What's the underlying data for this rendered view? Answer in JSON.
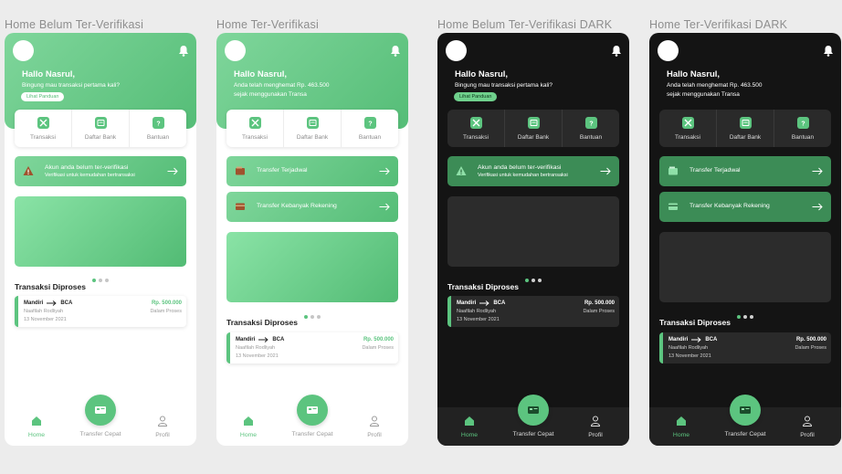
{
  "frames": [
    {
      "title": "Home Belum Ter-Verifikasi",
      "theme": "light",
      "greeting": "Hallo Nasrul,",
      "subtext_line1": "Bingung mau transaksi pertama kali?",
      "guide_button": "Lihat Panduan",
      "notice_title": "Akun anda belum ter-verifikasi",
      "notice_sub": "Verifikasi untuk kemudahan bertransaksi"
    },
    {
      "title": "Home Ter-Verifikasi",
      "theme": "light",
      "greeting": "Hallo Nasrul,",
      "subtext_line1": "Anda telah menghemat Rp. 463.500",
      "subtext_line2": "sejak menggunakan Transa",
      "action_1": "Transfer Terjadwal",
      "action_2": "Transfer Kebanyak Rekening"
    },
    {
      "title": "Home Belum Ter-Verifikasi DARK",
      "theme": "dark",
      "greeting": "Hallo Nasrul,",
      "subtext_line1": "Bingung mau transaksi pertama kali?",
      "guide_button": "Lihat Panduan",
      "notice_title": "Akun anda belum ter-verifikasi",
      "notice_sub": "Verifikasi untuk kemudahan bertransaksi"
    },
    {
      "title": "Home Ter-Verifikasi DARK",
      "theme": "dark",
      "greeting": "Hallo Nasrul,",
      "subtext_line1": "Anda telah menghemat Rp. 463.500",
      "subtext_line2": "sejak menggunakan Transa",
      "action_1": "Transfer Terjadwal",
      "action_2": "Transfer Kebanyak Rekening"
    }
  ],
  "menu": {
    "transaksi": "Transaksi",
    "daftar_bank": "Daftar Bank",
    "bantuan": "Bantuan"
  },
  "transactions": {
    "section_title": "Transaksi Diproses",
    "from_bank": "Mandiri",
    "to_bank": "BCA",
    "name": "Naafilah Rodliyah",
    "date": "13 November 2021",
    "amount": "Rp. 500.000",
    "status": "Dalam Proses"
  },
  "nav": {
    "home": "Home",
    "transfer_cepat": "Transfer Cepat",
    "profil": "Profil"
  },
  "colors": {
    "brand_green": "#5cc47f",
    "gradient_light": "#7fd69b",
    "gradient_dark": "#55bd77",
    "dark_bg": "#141414",
    "dark_card": "#2a2a2a",
    "dark_notice": "#3c8c56"
  },
  "icons": [
    "bell-icon",
    "transaksi-icon",
    "bank-list-icon",
    "help-icon",
    "warning-icon",
    "arrow-right-icon",
    "wallet-icon",
    "card-icon",
    "home-icon",
    "transfer-icon",
    "profile-icon"
  ],
  "carousel": {
    "pages": 3,
    "active_index": 0
  }
}
